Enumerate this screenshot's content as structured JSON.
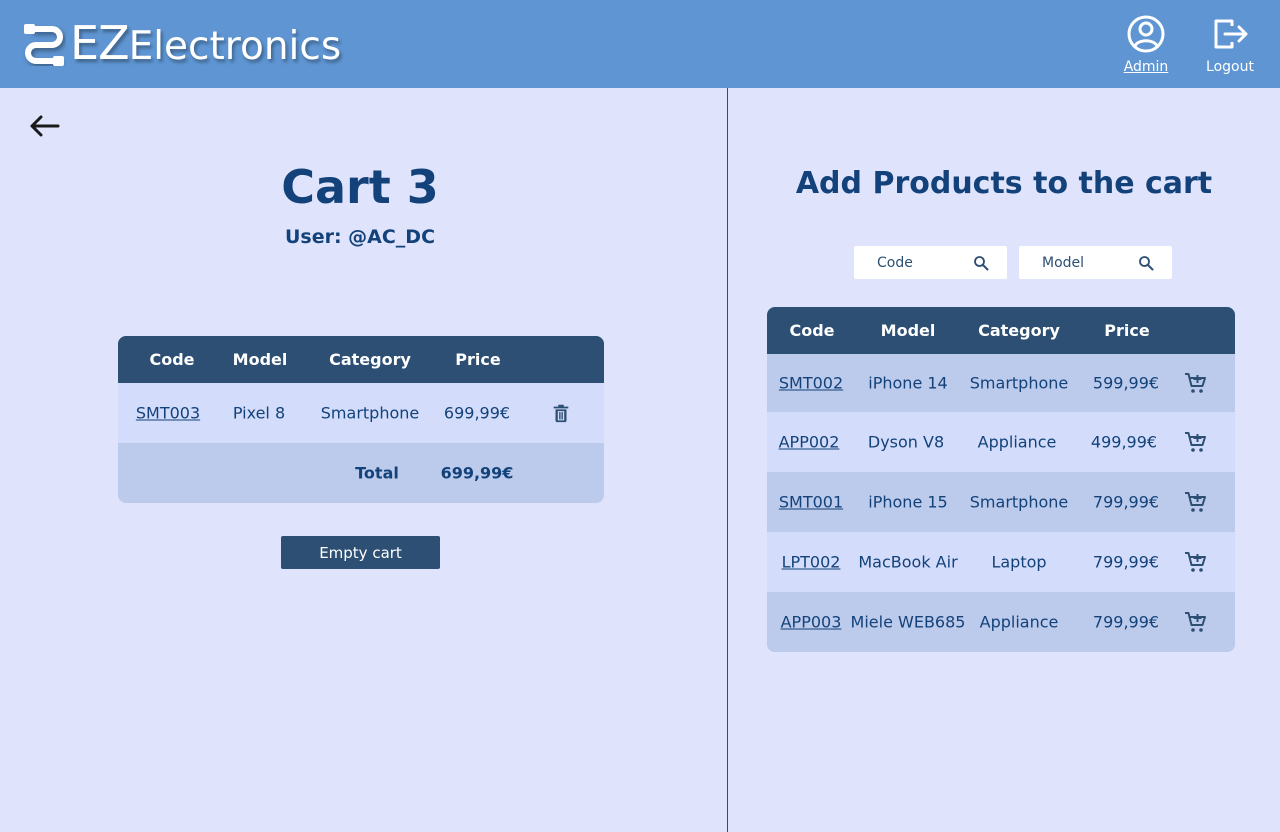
{
  "header": {
    "logo_ez": "EZ",
    "logo_rest": "Electronics",
    "admin_label": "Admin",
    "logout_label": "Logout"
  },
  "cart": {
    "title": "Cart 3",
    "user": "User: @AC_DC",
    "columns": [
      "Code",
      "Model",
      "Category",
      "Price"
    ],
    "items": [
      {
        "code": "SMT003",
        "model": "Pixel 8",
        "category": "Smartphone",
        "price": "699,99€"
      }
    ],
    "total_label": "Total",
    "total_value": "699,99€",
    "empty_button": "Empty cart"
  },
  "products": {
    "title": "Add Products to the cart",
    "search_code_placeholder": "Code",
    "search_model_placeholder": "Model",
    "columns": [
      "Code",
      "Model",
      "Category",
      "Price"
    ],
    "items": [
      {
        "code": "SMT002",
        "model": "iPhone 14",
        "category": "Smartphone",
        "price": "599,99€"
      },
      {
        "code": "APP002",
        "model": "Dyson V8",
        "category": "Appliance",
        "price": "499,99€"
      },
      {
        "code": "SMT001",
        "model": "iPhone 15",
        "category": "Smartphone",
        "price": "799,99€"
      },
      {
        "code": "LPT002",
        "model": "MacBook Air",
        "category": "Laptop",
        "price": "799,99€"
      },
      {
        "code": "APP003",
        "model": "Miele WEB685",
        "category": "Appliance",
        "price": "799,99€"
      }
    ]
  },
  "colors": {
    "header_bg": "#5e95d2",
    "page_bg": "#dfe3fb",
    "table_header": "#2c4f73",
    "row_dark": "#bccaeb",
    "row_light": "#d3dcfb",
    "text_primary": "#13427a"
  }
}
